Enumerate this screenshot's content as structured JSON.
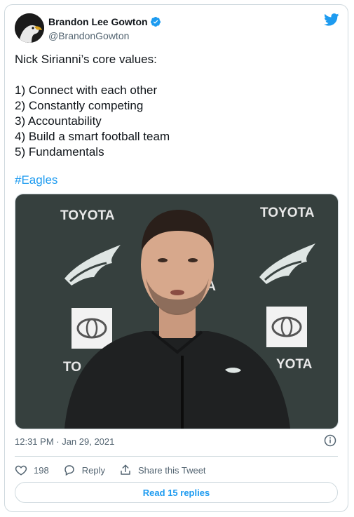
{
  "author": {
    "name": "Brandon Lee Gowton",
    "handle": "@BrandonGowton"
  },
  "tweet": {
    "text": "Nick Sirianni’s core values:\n\n1) Connect with each other\n2) Constantly competing\n3) Accountability\n4) Build a smart football team\n5) Fundamentals",
    "hashtag": "#Eagles"
  },
  "media": {
    "backdrop_text": "TOYOTA",
    "partial_texts": [
      "TO",
      "YOTA",
      "TA"
    ]
  },
  "meta": {
    "timestamp": "12:31 PM · Jan 29, 2021"
  },
  "actions": {
    "likes": "198",
    "reply_label": "Reply",
    "share_label": "Share this Tweet",
    "read_replies_label": "Read 15 replies"
  },
  "colors": {
    "accent": "#1d9bf0",
    "muted": "#536471",
    "border": "#cfd9de"
  },
  "icons": [
    "eagle-avatar-icon",
    "verified-badge-icon",
    "twitter-bird-icon",
    "info-icon",
    "heart-icon",
    "reply-icon",
    "share-icon"
  ]
}
